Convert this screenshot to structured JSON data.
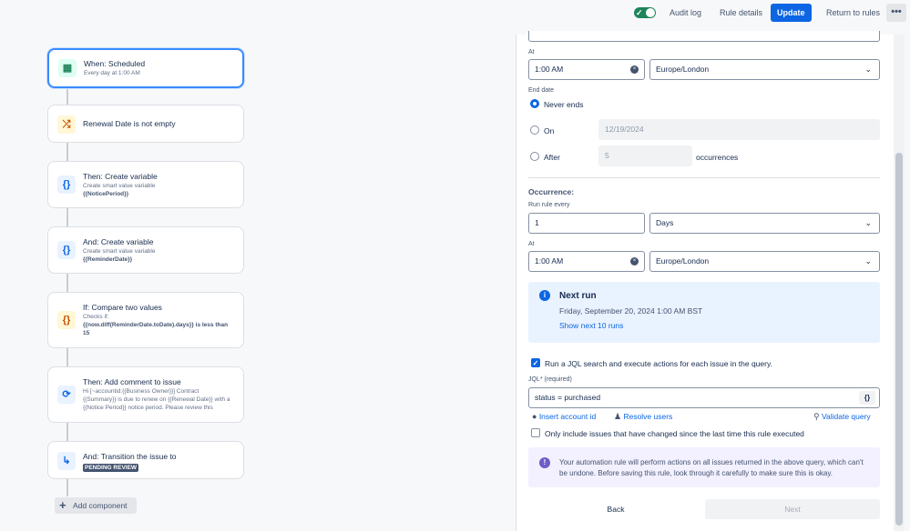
{
  "topbar": {
    "audit_log": "Audit log",
    "rule_details": "Rule details",
    "update": "Update",
    "return_to_rules": "Return to rules",
    "more": "•••",
    "toggle_check": "✓"
  },
  "chain": {
    "trigger": {
      "title": "When: Scheduled",
      "sub": "Every day at 1:00 AM",
      "icon": "▦"
    },
    "condition": {
      "title": "Renewal Date is not empty",
      "icon": "⤮"
    },
    "var1": {
      "title": "Then: Create variable",
      "sub": "Create smart value variable",
      "var": "{{NoticePeriod}}",
      "icon": "{}"
    },
    "var2": {
      "title": "And: Create variable",
      "sub": "Create smart value variable",
      "var": "{{ReminderDate}}",
      "icon": "{}"
    },
    "compare": {
      "title": "If: Compare two values",
      "sub": "Checks if:",
      "expr": "{{now.diff(ReminderDate.toDate).days}} is less than 15",
      "icon": "{}"
    },
    "comment": {
      "title": "Then: Add comment to issue",
      "sub": "Hi [~accountid:{{Business Owner}}] Contract {{Summary}} is due to renew on {{Renewal Date}} with a {{Notice Period}} notice period. Please review this contract and",
      "icon": "⟳"
    },
    "transition": {
      "title": "And: Transition the issue to",
      "status": "PENDING REVIEW",
      "icon": "↳"
    },
    "add_component": "Add component",
    "plus": "+"
  },
  "form": {
    "at_label": "At",
    "at_time": "1:00 AM",
    "timezone": "Europe/London",
    "end_date_label": "End date",
    "never_ends": "Never ends",
    "on": "On",
    "on_date": "12/19/2024",
    "after": "After",
    "after_count": "5",
    "occurrences": "occurrences",
    "occurrence_heading": "Occurrence:",
    "run_rule_every_label": "Run rule every",
    "run_every_value": "1",
    "unit": "Days",
    "at2_label": "At",
    "at2_time": "1:00 AM",
    "timezone2": "Europe/London",
    "next_run_title": "Next run",
    "next_run_date": "Friday, September 20, 2024 1:00 AM BST",
    "show_next": "Show next 10 runs",
    "jql_checkbox": "Run a JQL search and execute actions for each issue in the query.",
    "jql_label": "JQL* (required)",
    "jql_value": "status = purchased",
    "jql_btn": "{}",
    "insert_account_id": "Insert account id",
    "resolve_users": "Resolve users",
    "validate_query": "Validate query",
    "only_changed": "Only include issues that have changed since the last time this rule executed",
    "disclaimer": "Your automation rule will perform actions on all issues returned in the above query, which can't be undone. Before saving this rule, look through it carefully to make sure this is okay.",
    "back": "Back",
    "next": "Next",
    "info_icon": "i",
    "disc_icon": "!",
    "clear_icon": "×",
    "chevron": "⌄"
  }
}
